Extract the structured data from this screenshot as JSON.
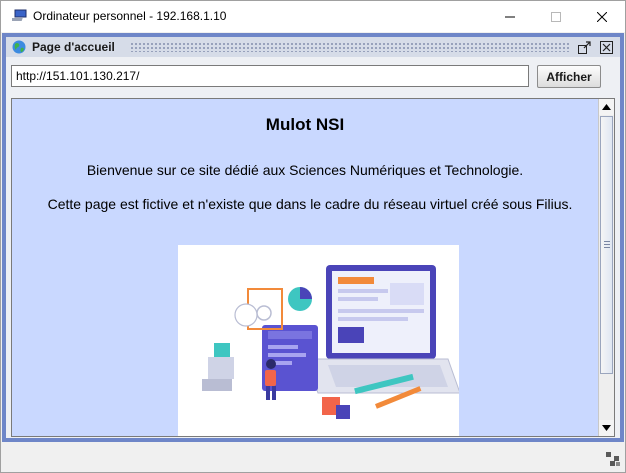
{
  "window": {
    "title": "Ordinateur personnel - 192.168.1.10",
    "controls": [
      "minimize-icon",
      "maximize-icon",
      "close-icon"
    ]
  },
  "frame": {
    "title": "Page d'accueil",
    "icons": [
      "globe-icon",
      "detach-icon",
      "close-icon"
    ]
  },
  "address_bar": {
    "value": "http://151.101.130.217/",
    "go_label": "Afficher"
  },
  "page": {
    "heading": "Mulot NSI",
    "paragraph1": "Bienvenue sur ce site dédié aux Sciences Numériques et Technologie.",
    "paragraph2": "Cette page est fictive et n'existe que dans le cadre du réseau virtuel créé sous Filius.",
    "background": "#c9d8ff"
  },
  "colors": {
    "frame_border": "#6e86c8",
    "accent_purple": "#4a44b8",
    "accent_orange": "#f28a3a",
    "accent_teal": "#3ec6c1"
  }
}
